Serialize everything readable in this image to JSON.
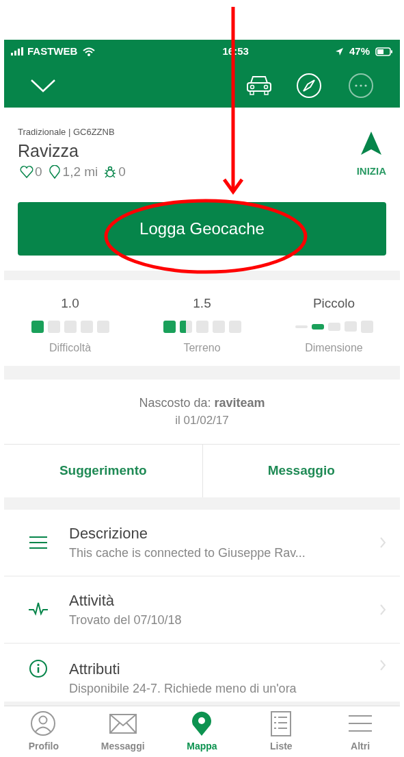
{
  "status_bar": {
    "carrier": "FASTWEB",
    "time": "16:53",
    "battery": "47%"
  },
  "cache": {
    "type_code": "Tradizionale | GC6ZZNB",
    "name": "Ravizza",
    "favorites": "0",
    "distance": "1,2 mi",
    "trackables": "0",
    "start_label": "INIZIA"
  },
  "log_button": "Logga Geocache",
  "ratings": [
    {
      "kind": "squares",
      "value": "1.0",
      "label": "Difficoltà",
      "stars": 1
    },
    {
      "kind": "squares",
      "value": "1.5",
      "label": "Terreno",
      "stars": 1.5
    },
    {
      "kind": "size",
      "value": "Piccolo",
      "label": "Dimensione",
      "sizes": [
        {
          "selected": false
        },
        {
          "selected": true
        },
        {
          "selected": false
        },
        {
          "selected": false
        },
        {
          "selected": false
        }
      ]
    }
  ],
  "hidden_by": {
    "text": "Nascosto da: **raviteam**",
    "date": "il 01/02/17"
  },
  "actions": [
    "Suggerimento",
    "Messaggio"
  ],
  "details": [
    {
      "kind": "description",
      "title": "Descrizione",
      "subtitle": "This cache is connected to Giuseppe Rav..."
    },
    {
      "kind": "activity",
      "title": "Attività",
      "subtitle": "Trovato del 07/10/18"
    },
    {
      "kind": "attributes",
      "title": "Attributi",
      "subtitle": "Disponibile 24-7. Richiede meno di un'ora"
    }
  ],
  "tab_bar": [
    {
      "kind": "profile",
      "label": "Profilo",
      "selected": false
    },
    {
      "kind": "messages",
      "label": "Messaggi",
      "selected": false
    },
    {
      "kind": "map",
      "label": "Mappa",
      "selected": true
    },
    {
      "kind": "lists",
      "label": "Liste",
      "selected": false
    },
    {
      "kind": "more",
      "label": "Altri",
      "selected": false
    }
  ]
}
